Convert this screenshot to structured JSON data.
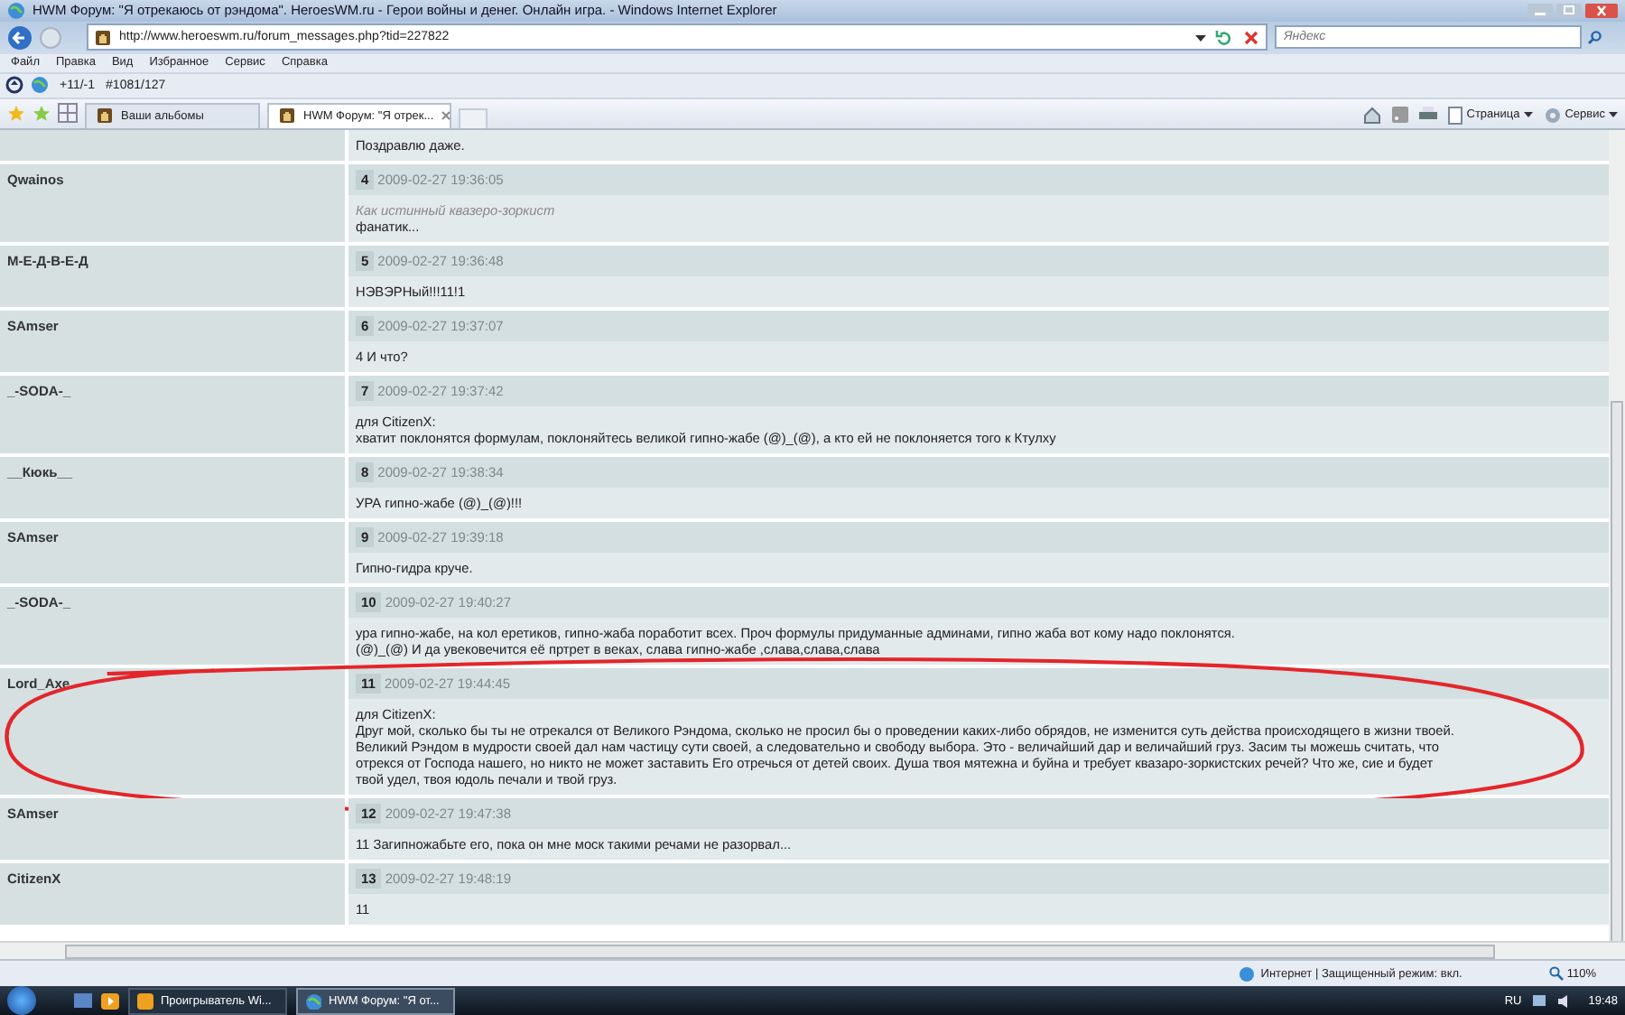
{
  "window": {
    "title": "HWM Форум: \"Я отрекаюсь от рэндома\". HeroesWM.ru - Герои войны и денег. Онлайн игра. - Windows Internet Explorer"
  },
  "address_bar": {
    "url": "http://www.heroeswm.ru/forum_messages.php?tid=227822",
    "search_placeholder": "Яндекс"
  },
  "menu": [
    "Файл",
    "Правка",
    "Вид",
    "Избранное",
    "Сервис",
    "Справка"
  ],
  "links_bar": {
    "counter": "+11/-1",
    "rank": "#1081/127"
  },
  "tabs": [
    {
      "label": "Ваши альбомы",
      "selected": false
    },
    {
      "label": "HWM Форум: \"Я отрек...",
      "selected": true
    }
  ],
  "command_bar": [
    "Страница",
    "Сервис"
  ],
  "posts": [
    {
      "lines": [
        {
          "text": "Поздравлю даже.",
          "kind": "plain"
        }
      ],
      "circled": false
    },
    {
      "author": "Qwainos",
      "number": "4",
      "date": "2009-02-27 19:36:05",
      "lines": [
        {
          "text": "Как истинный квазеро-зоркист",
          "kind": "quote"
        },
        {
          "text": "фанатик...",
          "kind": "plain"
        }
      ],
      "circled": false
    },
    {
      "author": "М-Е-Д-В-Е-Д",
      "number": "5",
      "date": "2009-02-27 19:36:48",
      "lines": [
        {
          "text": "НЭВЭРНый!!!11!1",
          "kind": "plain"
        }
      ],
      "circled": false
    },
    {
      "author": "SAmser",
      "number": "6",
      "date": "2009-02-27 19:37:07",
      "lines": [
        {
          "text": "4 И что?",
          "kind": "plain"
        }
      ],
      "circled": false
    },
    {
      "author": "_-SODA-_",
      "number": "7",
      "date": "2009-02-27 19:37:42",
      "lines": [
        {
          "text": "для CitizenX:",
          "kind": "plain"
        },
        {
          "text": "хватит поклонятся формулам, поклоняйтесь великой гипно-жабе (@)_(@), а кто ей не поклоняется того к Ктулху",
          "kind": "plain"
        }
      ],
      "circled": false
    },
    {
      "author": "__Кюкь__",
      "number": "8",
      "date": "2009-02-27 19:38:34",
      "lines": [
        {
          "text": "УРА гипно-жабе (@)_(@)!!!",
          "kind": "plain"
        }
      ],
      "circled": false
    },
    {
      "author": "SAmser",
      "number": "9",
      "date": "2009-02-27 19:39:18",
      "lines": [
        {
          "text": "Гипно-гидра круче.",
          "kind": "plain"
        }
      ],
      "circled": false
    },
    {
      "author": "_-SODA-_",
      "number": "10",
      "date": "2009-02-27 19:40:27",
      "lines": [
        {
          "text": "ура гипно-жабе, на кол еретиков, гипно-жаба поработит всех. Проч формулы придуманные админами, гипно жаба вот кому надо поклонятся.",
          "kind": "plain"
        },
        {
          "text": "(@)_(@) И да увековечится её пртрет в веках, слава гипно-жабе ,слава,слава,слава",
          "kind": "plain"
        }
      ],
      "circled": false
    },
    {
      "author": "Lord_Axe",
      "number": "11",
      "date": "2009-02-27 19:44:45",
      "lines": [
        {
          "text": "для CitizenX:",
          "kind": "plain"
        },
        {
          "text": "Друг мой, сколько бы ты не отрекался от Великого Рэндома, сколько не просил бы о проведении каких-либо обрядов, не изменится суть действа происходящего в жизни твоей.",
          "kind": "plain"
        },
        {
          "text": "Великий Рэндом в мудрости своей дал нам частицу сути своей, а следовательно и свободу выбора. Это - величайший дар и величайший груз. Засим ты можешь считать, что",
          "kind": "plain"
        },
        {
          "text": "отрекся от Господа нашего, но никто не может заставить Его отречься от детей своих. Душа твоя мятежна и буйна и требует квазаро-зоркистских речей? Что же, сие и будет",
          "kind": "plain"
        },
        {
          "text": "твой удел, твоя юдоль печали и твой груз.",
          "kind": "plain"
        }
      ],
      "circled": true
    },
    {
      "author": "SAmser",
      "number": "12",
      "date": "2009-02-27 19:47:38",
      "lines": [
        {
          "text": "11 Загипножабьте его, пока он мне моск такими речами не разорвал...",
          "kind": "plain"
        }
      ],
      "circled": false
    },
    {
      "author": "CitizenX",
      "number": "13",
      "date": "2009-02-27 19:48:19",
      "lines": [
        {
          "text": "11",
          "kind": "plain"
        }
      ],
      "circled": false
    }
  ],
  "status_bar": {
    "zone": "Интернет | Защищенный режим: вкл.",
    "zoom": "110%"
  },
  "taskbar": {
    "tasks": [
      {
        "label": "Проигрыватель Wi...",
        "selected": false
      },
      {
        "label": "HWM Форум: \"Я от...",
        "selected": true
      }
    ],
    "language": "RU",
    "time": "19:48"
  }
}
